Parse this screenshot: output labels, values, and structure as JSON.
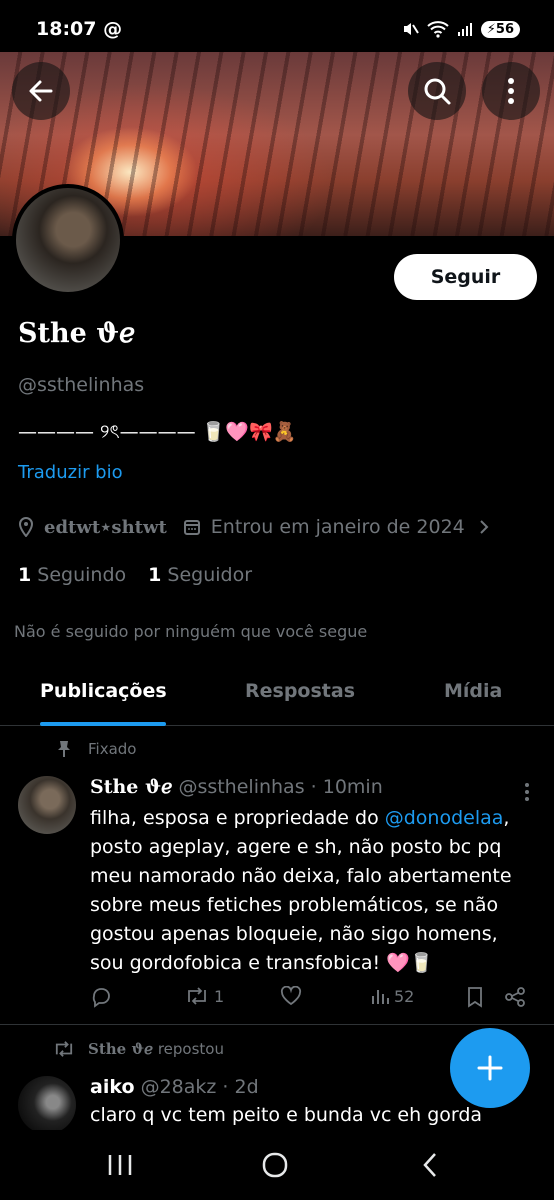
{
  "status_bar": {
    "time": "18:07",
    "at_sign": "@",
    "battery": "56"
  },
  "header_buttons": {
    "back": "back-arrow-icon",
    "search": "search-icon",
    "more": "more-vertical-icon"
  },
  "profile": {
    "display_name": "Sthe ϑℯ",
    "handle": "@ssthelinhas",
    "bio": "———— ୨ৎ———— 🥛🩷🎀🧸",
    "translate_label": "Traduzir bio",
    "location": "edtwt⋆shtwt",
    "joined": "Entrou em janeiro de 2024",
    "following_count": "1",
    "following_label": "Seguindo",
    "followers_count": "1",
    "followers_label": "Seguidor",
    "not_followed_text": "Não é seguido por ninguém que você segue",
    "follow_button": "Seguir"
  },
  "tabs": [
    {
      "label": "Publicações",
      "active": true
    },
    {
      "label": "Respostas",
      "active": false
    },
    {
      "label": "Mídia",
      "active": false
    }
  ],
  "pinned_post": {
    "pinned_label": "Fixado",
    "author_name": "Sthe ϑℯ",
    "author_handle": "@ssthelinhas",
    "time": "· 10min",
    "text_before": "filha, esposa e propriedade do ",
    "mention": "@donodelaa",
    "text_after": ", posto ageplay, agere e sh, não posto bc pq meu namorado não deixa, falo abertamente sobre meus fetiches problemáticos, se não gostou apenas bloqueie, não sigo homens, sou gordofobica e transfobica! 🩷🥛",
    "retweet_count": "1",
    "views_count": "52"
  },
  "repost": {
    "reposter": "Sthe ϑℯ",
    "reposted_label": "repostou",
    "author_name": "aiko",
    "author_handle": "@28akz",
    "time": "· 2d",
    "text": "claro q vc tem peito e bunda vc eh gorda"
  },
  "fab": {
    "icon": "plus-icon"
  },
  "colors": {
    "accent": "#1d9bf0",
    "background": "#000000",
    "muted": "#71767b"
  }
}
